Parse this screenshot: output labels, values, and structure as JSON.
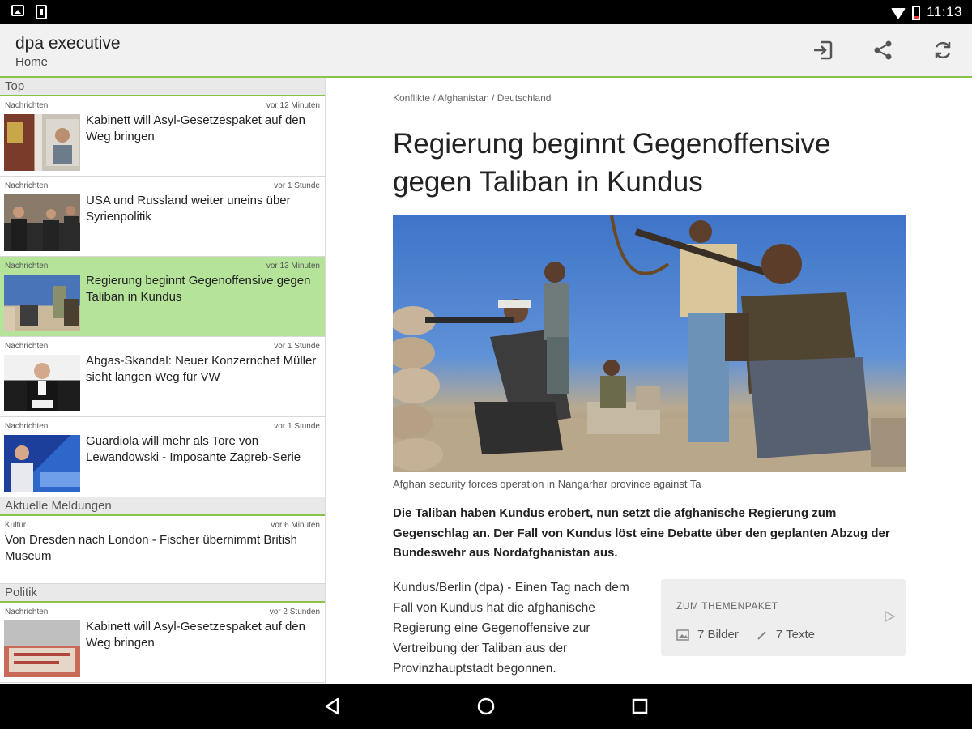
{
  "status_bar": {
    "time": "11:13"
  },
  "app_bar": {
    "title": "dpa executive",
    "subtitle": "Home",
    "actions": [
      "login-icon",
      "share-icon",
      "refresh-icon"
    ]
  },
  "sections": {
    "top": {
      "label": "Top",
      "items": [
        {
          "category": "Nachrichten",
          "time": "vor 12 Minuten",
          "headline": "Kabinett will Asyl-Gesetzespaket auf den Weg bringen"
        },
        {
          "category": "Nachrichten",
          "time": "vor 1 Stunde",
          "headline": "USA und Russland weiter uneins über Syrienpolitik"
        },
        {
          "category": "Nachrichten",
          "time": "vor 13 Minuten",
          "headline": "Regierung beginnt Gegenoffensive gegen Taliban in Kundus"
        },
        {
          "category": "Nachrichten",
          "time": "vor 1 Stunde",
          "headline": "Abgas-Skandal: Neuer Konzernchef Müller sieht langen Weg für VW"
        },
        {
          "category": "Nachrichten",
          "time": "vor 1 Stunde",
          "headline": "Guardiola will mehr als Tore von Lewandowski - Imposante Zagreb-Serie"
        }
      ]
    },
    "aktuell": {
      "label": "Aktuelle Meldungen",
      "items": [
        {
          "category": "Kultur",
          "time": "vor 6 Minuten",
          "headline": "Von Dresden nach London - Fischer übernimmt British Museum"
        }
      ]
    },
    "politik": {
      "label": "Politik",
      "items": [
        {
          "category": "Nachrichten",
          "time": "vor 2 Stunden",
          "headline": "Kabinett will Asyl-Gesetzespaket auf den Weg bringen"
        }
      ]
    }
  },
  "article": {
    "breadcrumb": "Konflikte / Afghanistan / Deutschland",
    "title": "Regierung beginnt Gegenoffensive gegen Taliban in Kundus",
    "caption": "Afghan security forces operation in Nangarhar province against Ta",
    "lead": "Die Taliban haben Kundus erobert, nun setzt die afghanische Regierung zum Gegenschlag an. Der Fall von Kundus löst eine Debatte über den geplanten Abzug der Bundeswehr aus Nordafghanistan aus.",
    "body": "Kundus/Berlin (dpa) - Einen Tag nach dem Fall von Kundus hat die afghanische Regierung eine Gegenoffensive zur Vertreibung der Taliban aus der Provinzhauptstadt begonnen.",
    "topic_box": {
      "title": "ZUM THEMENPAKET",
      "images": "7 Bilder",
      "texts": "7 Texte"
    }
  },
  "colors": {
    "accent": "#8bc34a",
    "active_item": "#b5e39a"
  }
}
